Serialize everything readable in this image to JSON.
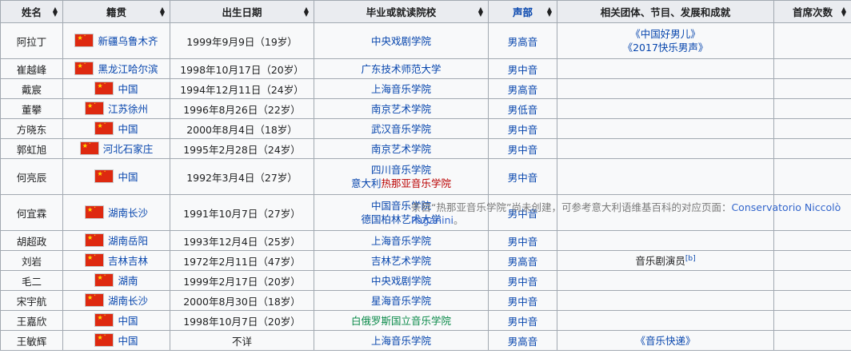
{
  "headers": [
    {
      "label": "姓名",
      "sorted": false
    },
    {
      "label": "籍贯",
      "sorted": false
    },
    {
      "label": "出生日期",
      "sorted": false
    },
    {
      "label": "毕业或就读院校",
      "sorted": false
    },
    {
      "label": "声部",
      "sorted": true
    },
    {
      "label": "相关团体、节目、发展和成就",
      "sorted": false,
      "nosort": true
    },
    {
      "label": "首席次数",
      "sorted": false
    }
  ],
  "rows": [
    {
      "name": "阿拉丁",
      "hometown": "新疆乌鲁木齐",
      "birth": "1999年9月9日（19岁）",
      "school": [
        "中央戏剧学院"
      ],
      "voice": "男高音",
      "notes": [
        "《中国好男儿》",
        "《2017快乐男声》"
      ]
    },
    {
      "name": "崔越峰",
      "hometown": "黑龙江哈尔滨",
      "birth": "1998年10月17日（20岁）",
      "school": [
        "广东技术师范大学"
      ],
      "voice": "男中音",
      "notes": []
    },
    {
      "name": "戴宸",
      "hometown": "中国",
      "birth": "1994年12月11日（24岁）",
      "school": [
        "上海音乐学院"
      ],
      "voice": "男高音",
      "notes": []
    },
    {
      "name": "董攀",
      "hometown": "江苏徐州",
      "birth": "1996年8月26日（22岁）",
      "school": [
        "南京艺术学院"
      ],
      "voice": "男低音",
      "notes": []
    },
    {
      "name": "方晓东",
      "hometown": "中国",
      "birth": "2000年8月4日（18岁）",
      "school": [
        "武汉音乐学院"
      ],
      "voice": "男中音",
      "notes": []
    },
    {
      "name": "郭虹旭",
      "hometown": "河北石家庄",
      "birth": "1995年2月28日（24岁）",
      "school": [
        "南京艺术学院"
      ],
      "voice": "男中音",
      "notes": []
    },
    {
      "name": "何亮辰",
      "hometown": "中国",
      "birth": "1992年3月4日（27岁）",
      "school": [
        "四川音乐学院",
        "意大利热那亚音乐学院"
      ],
      "voice": "男中音",
      "notes": []
    },
    {
      "name": "何宜霖",
      "hometown": "湖南长沙",
      "birth": "1991年10月7日（27岁）",
      "school": [
        "中国音乐学院",
        "德国柏林艺术大学"
      ],
      "voice": "男中音",
      "notes": []
    },
    {
      "name": "胡超政",
      "hometown": "湖南岳阳",
      "birth": "1993年12月4日（25岁）",
      "school": [
        "上海音乐学院"
      ],
      "voice": "男中音",
      "notes": []
    },
    {
      "name": "刘岩",
      "hometown": "吉林吉林",
      "birth": "1972年2月11日（47岁）",
      "school": [
        "吉林艺术学院"
      ],
      "voice": "男高音",
      "notes": [
        "音乐剧演员"
      ],
      "note_sup": "[b]"
    },
    {
      "name": "毛二",
      "hometown": "湖南",
      "birth": "1999年2月17日（20岁）",
      "school": [
        "中央戏剧学院"
      ],
      "voice": "男中音",
      "notes": []
    },
    {
      "name": "宋宇航",
      "hometown": "湖南长沙",
      "birth": "2000年8月30日（18岁）",
      "school": [
        "星海音乐学院"
      ],
      "voice": "男中音",
      "notes": []
    },
    {
      "name": "王嘉欣",
      "hometown": "中国",
      "birth": "1998年10月7日（20岁）",
      "school": [
        "白俄罗斯国立音乐学院"
      ],
      "voice": "男中音",
      "notes": []
    },
    {
      "name": "王敏辉",
      "hometown": "中国",
      "birth": "不详",
      "school": [
        "上海音乐学院"
      ],
      "voice": "男高音",
      "notes": [
        "《音乐快递》"
      ]
    }
  ],
  "tooltip": {
    "text": "条目“热那亚音乐学院”尚未创建，可参考意大利语维基百科的对应页面：",
    "link": "Conservatorio Niccolò Paganini",
    "suffix": "。"
  },
  "colors": {
    "header_bg": "#eaecf0",
    "cell_bg": "#f8f9fa",
    "border": "#a2a9b1",
    "link": "#0645ad",
    "redlink": "#ba0000",
    "flag_red": "#de2910"
  }
}
